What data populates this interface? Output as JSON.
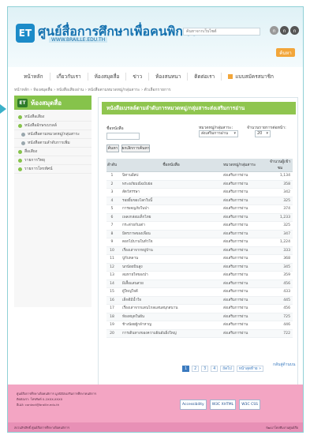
{
  "header": {
    "logo_text": "ET",
    "site_title": "ศูนย์สื่อการศึกษาเพื่อคนพิการ",
    "site_url": "WWW.BRAILLE.EDU.TH",
    "search_placeholder": "ค้นหาจากเว็บไซต์",
    "font_sizes": [
      "ก",
      "ก",
      "ก"
    ],
    "search_button": "ค้นหา"
  },
  "nav": {
    "items": [
      "หน้าหลัก",
      "เกี่ยวกับเรา",
      "ห้องสมุดสื่อ",
      "ข่าว",
      "ห้องสนทนา",
      "ติดต่อเรา"
    ],
    "member_label": "แบบสมัครสมาชิก"
  },
  "breadcrumb": "หน้าหลัก › ห้องสมุดสื่อ › หนังสือเสียงอ่าน › หนังสือตามหมวดหมู่/กลุ่มสาระ › ตัวเลือกรายการ",
  "sidebar": {
    "badge": "ET",
    "title": "ห้องสมุดสื่อ",
    "items": [
      {
        "label": "หนังสือเสียง",
        "sub": false
      },
      {
        "label": "หนังสืออักษรเบรลล์",
        "sub": false
      },
      {
        "label": "หนังสือตามหมวดหมู่/กลุ่มสาระ",
        "sub": true
      },
      {
        "label": "หนังสือตามลำดับการเพิ่ม",
        "sub": true
      },
      {
        "label": "สื่อเสียง",
        "sub": false
      },
      {
        "label": "รายการวิทยุ",
        "sub": false
      },
      {
        "label": "รายการโทรทัศน์",
        "sub": false
      }
    ]
  },
  "main": {
    "title": "หนังสือเบรลล์ตามลำดับการหมวดหมู่/กลุ่มสาระส่งเสริมการอ่าน",
    "filter_name_label": "ชื่อหนังสือ",
    "filter_group_label": "หมวดหมู่/กลุ่มสาระ:",
    "filter_group_value": "ส่งเสริมการอ่าน",
    "filter_perpage_label": "จำนวนรายการต่อหน้า:",
    "filter_perpage_value": "20",
    "search_button": "ค้นหา",
    "clear_button": "ยกเลิกการค้นหา",
    "columns": [
      "ลำดับ",
      "ชื่อหนังสือ",
      "หมวดหมู่/กลุ่มสาระ",
      "จำนวนผู้เข้าชม"
    ],
    "rows": [
      {
        "no": "1",
        "name": "นิทานอีสป",
        "group": "ส่งเสริมการอ่าน",
        "count": "1,134"
      },
      {
        "no": "2",
        "name": "พระอภัยมณีฉบับย่อ",
        "group": "ส่งเสริมการอ่าน",
        "count": "358"
      },
      {
        "no": "3",
        "name": "สัตว์หรรษา",
        "group": "ส่งเสริมการอ่าน",
        "count": "342"
      },
      {
        "no": "4",
        "name": "รอยยิ้มของโลกใบนี้",
        "group": "ส่งเสริมการอ่าน",
        "count": "325"
      },
      {
        "no": "5",
        "name": "การผจญภัยในป่า",
        "group": "ส่งเสริมการอ่าน",
        "count": "374"
      },
      {
        "no": "6",
        "name": "เพลงกล่อมเด็กไทย",
        "group": "ส่งเสริมการอ่าน",
        "count": "1,233"
      },
      {
        "no": "7",
        "name": "กระต่ายกับเต่า",
        "group": "ส่งเสริมการอ่าน",
        "count": "325"
      },
      {
        "no": "8",
        "name": "มิตรภาพของเพื่อน",
        "group": "ส่งเสริมการอ่าน",
        "count": "347"
      },
      {
        "no": "9",
        "name": "ดอกไม้บานในหัวใจ",
        "group": "ส่งเสริมการอ่าน",
        "count": "1,224"
      },
      {
        "no": "10",
        "name": "เรื่องเล่าจากหมู่บ้าน",
        "group": "ส่งเสริมการอ่าน",
        "count": "333"
      },
      {
        "no": "11",
        "name": "ปู่กับหลาน",
        "group": "ส่งเสริมการอ่าน",
        "count": "368"
      },
      {
        "no": "12",
        "name": "นกน้อยบินสูง",
        "group": "ส่งเสริมการอ่าน",
        "count": "345"
      },
      {
        "no": "13",
        "name": "ลมหายใจของป่า",
        "group": "ส่งเสริมการอ่าน",
        "count": "359"
      },
      {
        "no": "14",
        "name": "ผีเสื้อแสนสวย",
        "group": "ส่งเสริมการอ่าน",
        "count": "456"
      },
      {
        "no": "15",
        "name": "ผู้ใหญ่ใจดี",
        "group": "ส่งเสริมการอ่าน",
        "count": "433"
      },
      {
        "no": "16",
        "name": "เด็กดีมีน้ำใจ",
        "group": "ส่งเสริมการอ่าน",
        "count": "445"
      },
      {
        "no": "17",
        "name": "เรื่องเล่าจากแดนไกลแสนสนุกสนาน",
        "group": "ส่งเสริมการอ่าน",
        "count": "456"
      },
      {
        "no": "18",
        "name": "ห้องสมุดในฝัน",
        "group": "ส่งเสริมการอ่าน",
        "count": "725"
      },
      {
        "no": "19",
        "name": "ช้างน้อยผู้กล้าหาญ",
        "group": "ส่งเสริมการอ่าน",
        "count": "446"
      },
      {
        "no": "20",
        "name": "การเดินทางของความฝันอันยิ่งใหญ่",
        "group": "ส่งเสริมการอ่าน",
        "count": "722"
      }
    ],
    "pages": [
      "1",
      "2",
      "3",
      "4"
    ],
    "next_label": "ถัดไป",
    "last_label": "หน้าสุดท้าย »",
    "back_to_top": "กลับสู่ด้านบน"
  },
  "footer": {
    "line1": "ศูนย์สื่อการศึกษาเพื่อคนพิการ มูลนิธิส่งเสริมการศึกษาคนพิการ",
    "line2": "ติดต่อเรา: โทรศัพท์ 0-2XXX-XXXX",
    "line3": "อีเมล: contact@braille.edu.th",
    "badges": [
      "Accessibility",
      "W3C XHTML",
      "W3C CSS"
    ],
    "copyright": "สงวนลิขสิทธิ์ ศูนย์สื่อการศึกษาเพื่อคนพิการ",
    "credit": "พัฒนาโดยทีมงานศูนย์สื่อ"
  }
}
